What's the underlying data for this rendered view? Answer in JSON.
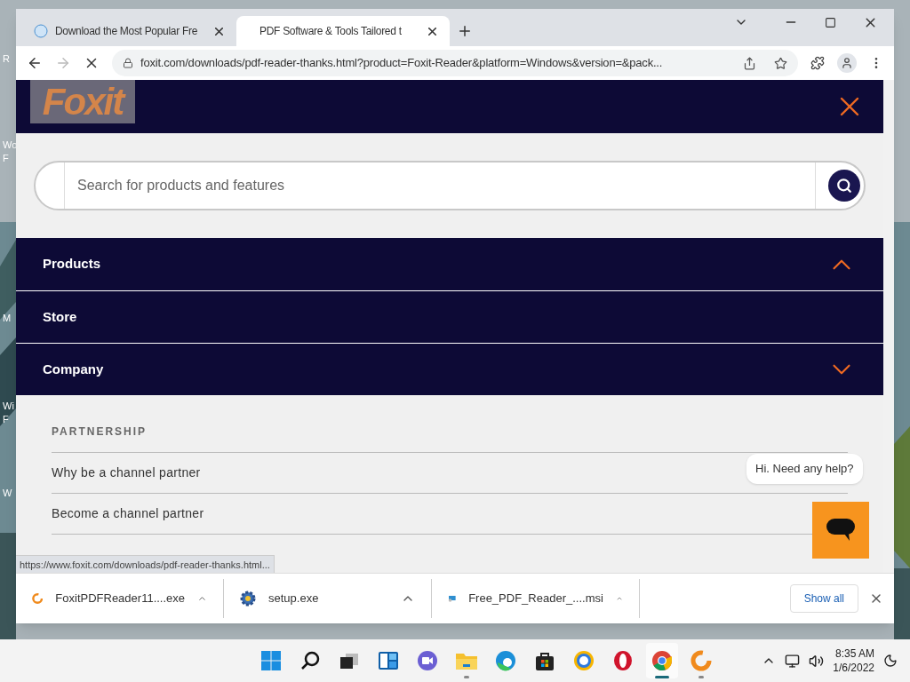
{
  "desktop": {
    "icon_labels": [
      "R",
      "Wo",
      "F",
      "M",
      "Wi",
      "F",
      "W"
    ]
  },
  "browser": {
    "tabs": [
      {
        "title": "Download the Most Popular Fre",
        "selected": false
      },
      {
        "title": "PDF Software & Tools Tailored t",
        "selected": true
      }
    ],
    "address": "foxit.com/downloads/pdf-reader-thanks.html?product=Foxit-Reader&platform=Windows&version=&pack...",
    "loading": true
  },
  "page": {
    "logo": "Foxit",
    "search": {
      "placeholder": "Search for products and features"
    },
    "nav": [
      {
        "label": "Products",
        "kind": "expandable",
        "expanded": true
      },
      {
        "label": "Store",
        "kind": "link"
      },
      {
        "label": "Company",
        "kind": "expandable",
        "expanded": false
      }
    ],
    "section_heading": "PARTNERSHIP",
    "links": [
      "Why be a channel partner",
      "Become a channel partner"
    ],
    "chat": {
      "greeting": "Hi. Need any help?"
    }
  },
  "status_url": "https://www.foxit.com/downloads/pdf-reader-thanks.html...",
  "downloads": {
    "items": [
      {
        "name": "FoxitPDFReader11....exe",
        "kind": "foxit"
      },
      {
        "name": "setup.exe",
        "kind": "gear"
      },
      {
        "name": "Free_PDF_Reader_....msi",
        "kind": "installer"
      }
    ],
    "show_all": "Show all"
  },
  "taskbar": {
    "apps": [
      {
        "kind": "start",
        "running": false,
        "active": false
      },
      {
        "kind": "search",
        "running": false,
        "active": false
      },
      {
        "kind": "taskview",
        "running": false,
        "active": false
      },
      {
        "kind": "widgets",
        "running": false,
        "active": false
      },
      {
        "kind": "chat",
        "running": false,
        "active": false
      },
      {
        "kind": "explorer",
        "running": true,
        "active": false
      },
      {
        "kind": "edge",
        "running": false,
        "active": false
      },
      {
        "kind": "store",
        "running": false,
        "active": false
      },
      {
        "kind": "browser",
        "running": false,
        "active": false
      },
      {
        "kind": "opera",
        "running": false,
        "active": false
      },
      {
        "kind": "chrome",
        "running": true,
        "active": true
      },
      {
        "kind": "foxit",
        "running": true,
        "active": false
      }
    ],
    "time": "8:35 AM",
    "date": "1/6/2022"
  }
}
